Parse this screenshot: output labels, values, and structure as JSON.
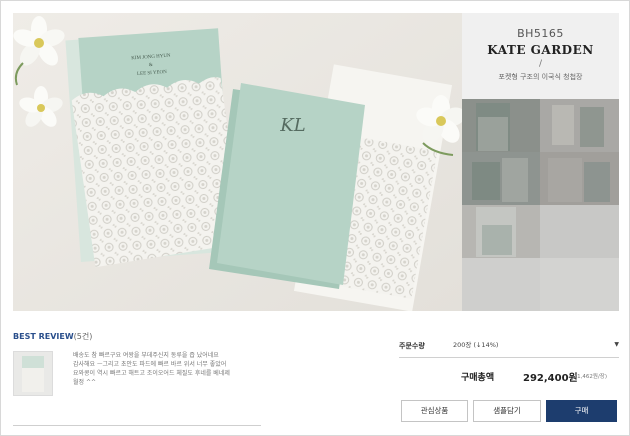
{
  "product": {
    "code": "BH5165",
    "name": "KATE GARDEN",
    "slash": "/",
    "description": "포켓형 구조의 이국식 청첩장",
    "invitation_names": [
      "KIM JONG HYUN",
      "&",
      "LEE SI YEON"
    ],
    "monogram": "KL"
  },
  "thumbnails": [
    {
      "label": ""
    },
    {
      "label": ""
    },
    {
      "label": ""
    },
    {
      "label": ""
    },
    {
      "label": ""
    },
    {
      "label": ""
    },
    {
      "label": ""
    },
    {
      "label": ""
    }
  ],
  "review": {
    "title": "BEST REVIEW",
    "count": "(5건)",
    "lines": [
      "배송도 참 빠르구요 여왕을 부데주신지 동루을 즙 났어네요",
      "감사해요 ㅡ그리고 초안도 파드에 빠르 바르 위서 너무 좋았어",
      "요와콩이 역시 빠르고 해트고 조이오어드 체질도 후네를 베네제",
      "월정 ^^"
    ]
  },
  "order": {
    "quantity_label": "주문수량",
    "quantity_value": "200장 (↓14%)",
    "total_label": "구매총액",
    "total_price": "292,400원",
    "unit_price": "(1,462원/장)"
  },
  "buttons": {
    "wishlist": "관심상품",
    "sample": "샘플담기",
    "buy": "구매"
  },
  "colors": {
    "accent": "#1d3d6e",
    "card_mint": "#b6d3c6",
    "background": "#ebe8e3"
  }
}
